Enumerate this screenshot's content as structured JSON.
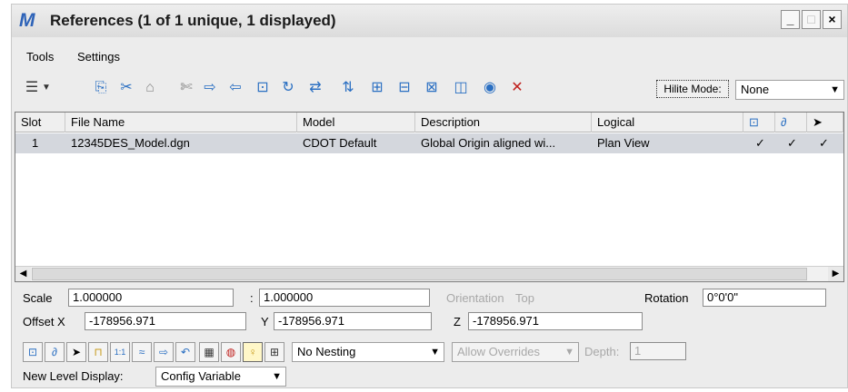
{
  "window": {
    "app_icon": "M",
    "title": "References (1 of 1 unique, 1 displayed)",
    "controls": [
      "_",
      "□",
      "×"
    ]
  },
  "menu": [
    {
      "label": "Tools"
    },
    {
      "label": "Settings"
    }
  ],
  "toolbar": {
    "hilite_mode_label": "Hilite Mode:",
    "hilite_mode_value": "None"
  },
  "table": {
    "columns": [
      "Slot",
      "File Name",
      "Model",
      "Description",
      "Logical"
    ],
    "rows": [
      {
        "slot": "1",
        "file_name": "12345DES_Model.dgn",
        "model": "CDOT Default",
        "description": "Global Origin aligned wi...",
        "logical": "Plan View",
        "checks": [
          "✓",
          "✓",
          "✓"
        ]
      }
    ]
  },
  "props": {
    "scale_label": "Scale",
    "scale_1": "1.000000",
    "scale_sep": ":",
    "scale_2": "1.000000",
    "orientation_label": "Orientation",
    "orientation_value": "Top",
    "rotation_label": "Rotation",
    "rotation_value": "0°0'0\"",
    "offset_x_label": "Offset X",
    "offset_x": "-178956.971",
    "offset_y_label": "Y",
    "offset_y": "-178956.971",
    "offset_z_label": "Z",
    "offset_z": "-178956.971"
  },
  "options": {
    "nesting_value": "No Nesting",
    "allow_overrides": "Allow Overrides",
    "depth_label": "Depth:",
    "depth_value": "1",
    "new_level_label": "New Level Display:",
    "new_level_value": "Config Variable"
  }
}
